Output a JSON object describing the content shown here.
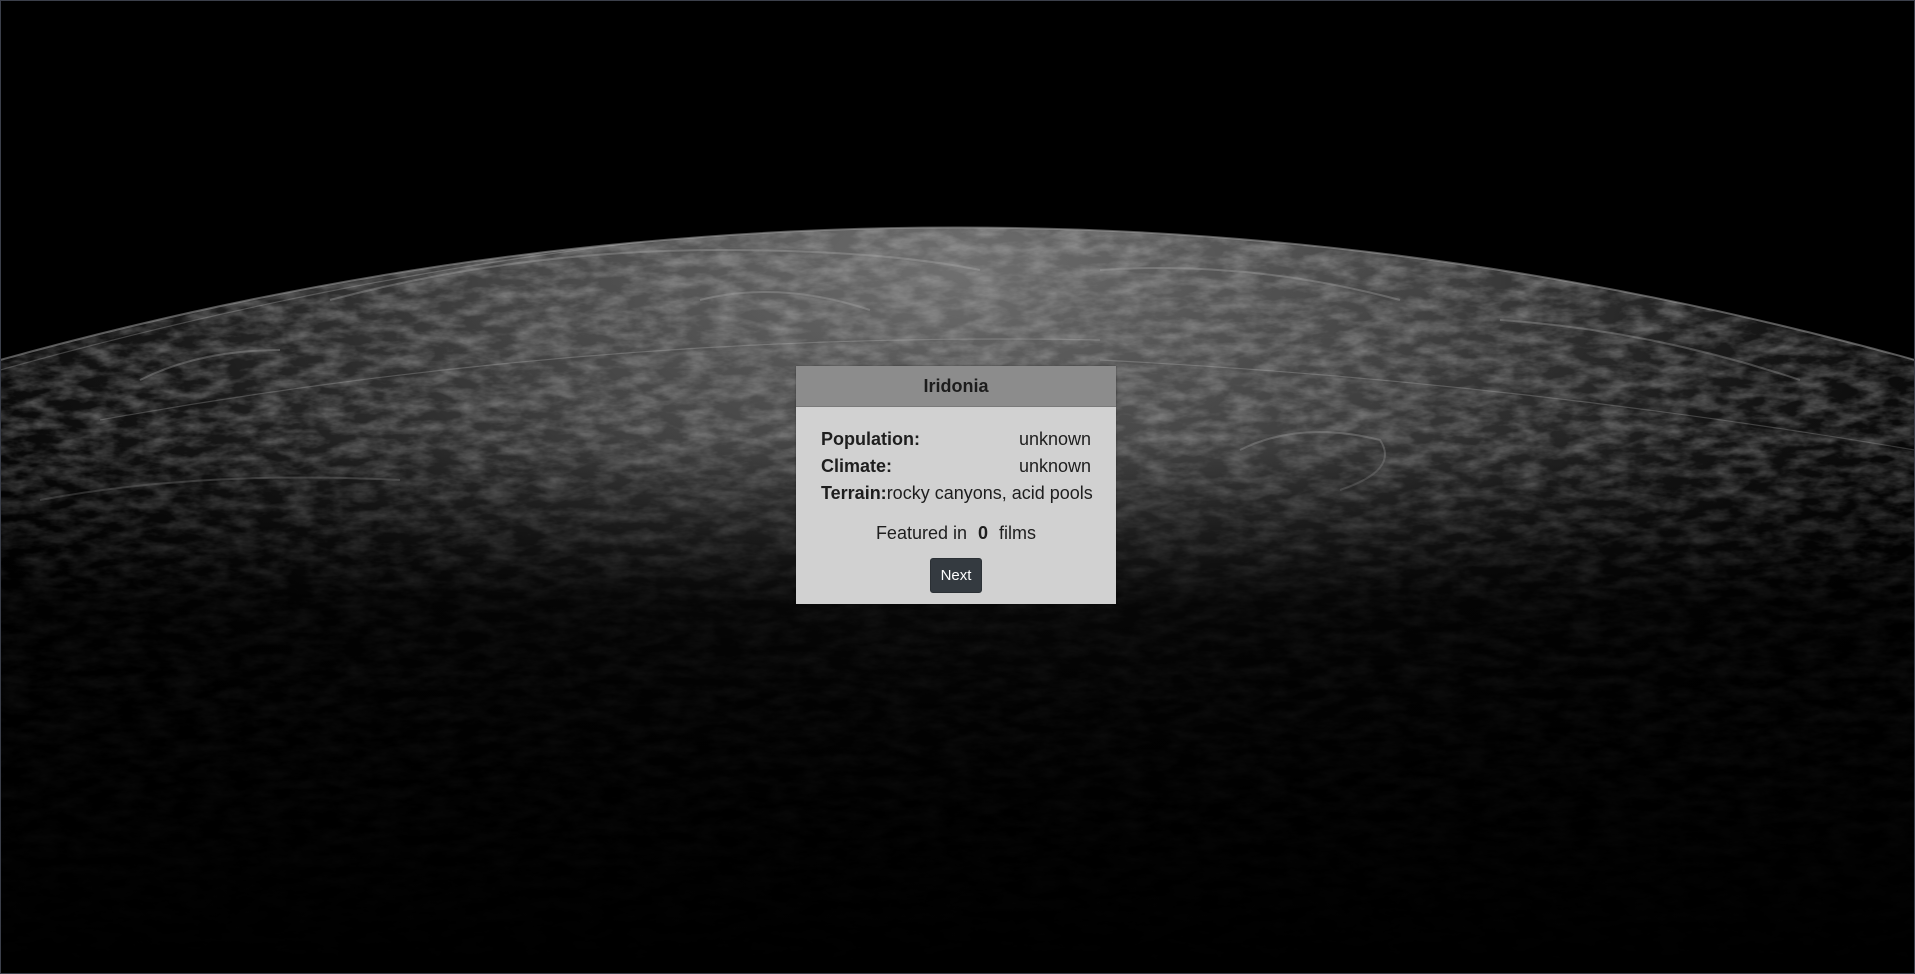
{
  "planet": {
    "name": "Iridonia",
    "details": [
      {
        "label": "Population:",
        "value": "unknown"
      },
      {
        "label": "Climate:",
        "value": "unknown"
      },
      {
        "label": "Terrain:",
        "value": "rocky canyons, acid pools"
      }
    ],
    "featured_prefix": "Featured in",
    "featured_count": "0",
    "featured_suffix": "films"
  },
  "controls": {
    "next_label": "Next"
  },
  "background": {
    "image": "moon-surface",
    "colors": {
      "space": "#000000",
      "surface": "#5a5a5a",
      "header": "#8c8c8c",
      "card": "#d1d1d1",
      "button": "#343a40"
    }
  }
}
